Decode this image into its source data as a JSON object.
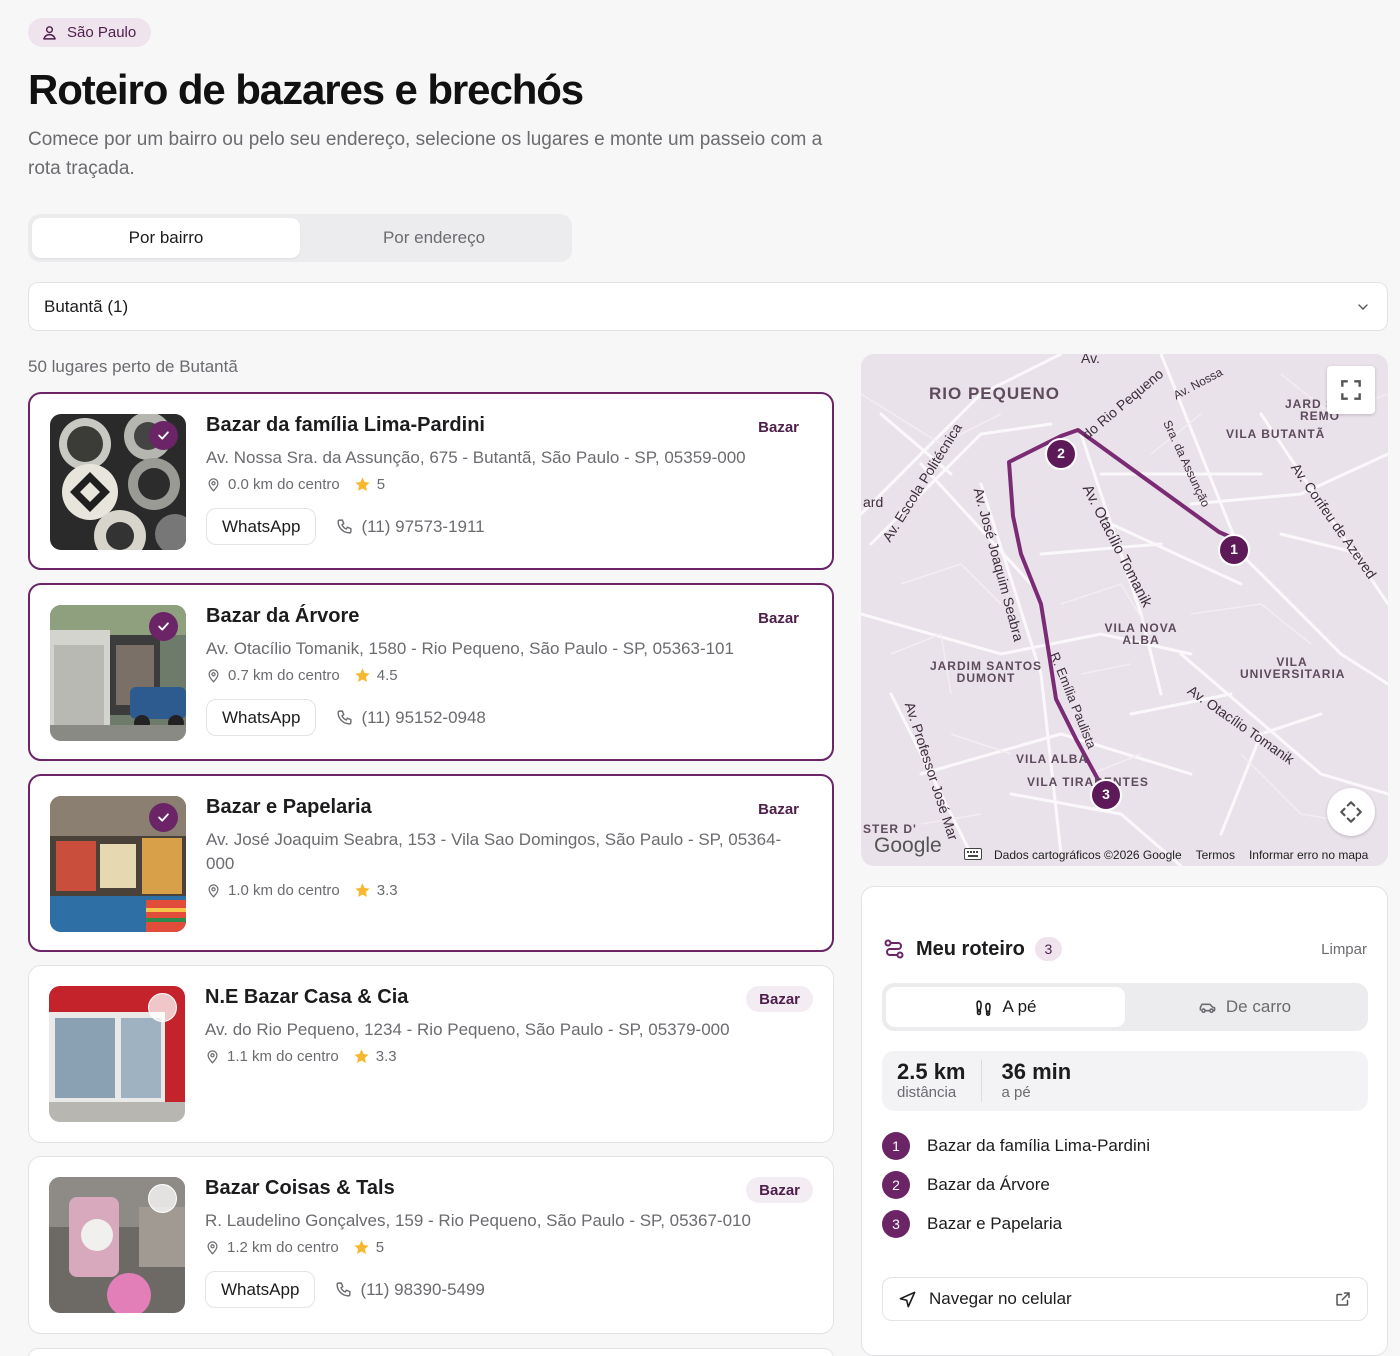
{
  "location": {
    "label": "São Paulo",
    "icon": "user-pin-icon"
  },
  "page": {
    "title": "Roteiro de bazares e brechós",
    "subtitle": "Comece por um bairro ou pelo seu endereço, selecione os lugares e monte um passeio com a rota traçada."
  },
  "search_mode": {
    "tabs": [
      {
        "label": "Por bairro",
        "active": true
      },
      {
        "label": "Por endereço",
        "active": false
      }
    ]
  },
  "neighborhood_select": {
    "value": "Butantã (1)"
  },
  "results": {
    "summary": "50 lugares perto de Butantã",
    "items": [
      {
        "name": "Bazar da família Lima-Pardini",
        "category": "Bazar",
        "address": "Av. Nossa Sra. da Assunção, 675 - Butantã, São Paulo - SP, 05359-000",
        "distance": "0.0 km do centro",
        "rating": "5",
        "whatsapp": "WhatsApp",
        "phone": "(11) 97573-1911",
        "selected": true
      },
      {
        "name": "Bazar da Árvore",
        "category": "Bazar",
        "address": "Av. Otacílio Tomanik, 1580 - Rio Pequeno, São Paulo - SP, 05363-101",
        "distance": "0.7 km do centro",
        "rating": "4.5",
        "whatsapp": "WhatsApp",
        "phone": "(11) 95152-0948",
        "selected": true
      },
      {
        "name": "Bazar e Papelaria",
        "category": "Bazar",
        "address": "Av. José Joaquim Seabra, 153 - Vila Sao Domingos, São Paulo - SP, 05364-000",
        "distance": "1.0 km do centro",
        "rating": "3.3",
        "selected": true
      },
      {
        "name": "N.E Bazar Casa & Cia",
        "category": "Bazar",
        "address": "Av. do Rio Pequeno, 1234 - Rio Pequeno, São Paulo - SP, 05379-000",
        "distance": "1.1 km do centro",
        "rating": "3.3",
        "selected": false
      },
      {
        "name": "Bazar Coisas & Tals",
        "category": "Bazar",
        "address": "R. Laudelino Gonçalves, 159 - Rio Pequeno, São Paulo - SP, 05367-010",
        "distance": "1.2 km do centro",
        "rating": "5",
        "whatsapp": "WhatsApp",
        "phone": "(11) 98390-5499",
        "selected": false
      }
    ]
  },
  "map": {
    "areas": [
      "RIO PEQUENO",
      "JARD SAO REMO",
      "VILA BUTANTÃ",
      "VILA NOVA ALBA",
      "JARDIM SANTOS DUMONT",
      "VILA UNIVERSITARIA",
      "VILA ALBA",
      "VILA TIRADENTES",
      "STER D'"
    ],
    "streets": [
      "Av. Escola Politécnica",
      "do Rio Pequeno",
      "Av. José Joaquim Seabra",
      "Av. Otacílio Tomanik",
      "Sra. da Assunção",
      "Av. Corifeu de Azeved",
      "R. Emília Paulista",
      "Av. Professor José Mar",
      "Av. Otacílio Tomanik",
      "Av.",
      "ard",
      "Av. Nossa"
    ],
    "markers": [
      "1",
      "2",
      "3"
    ],
    "brand": "Google",
    "attribution": [
      "Dados cartográficos ©2026 Google",
      "Termos",
      "Informar erro no mapa"
    ],
    "route_color": "#7a2b74"
  },
  "itinerary": {
    "title": "Meu roteiro",
    "count": "3",
    "clear_label": "Limpar",
    "modes": [
      {
        "label": "A pé",
        "icon": "footprints-icon",
        "active": true
      },
      {
        "label": "De carro",
        "icon": "car-icon",
        "active": false
      }
    ],
    "distance_value": "2.5 km",
    "distance_label": "distância",
    "time_value": "36 min",
    "time_label": "a pé",
    "stops": [
      {
        "num": "1",
        "name": "Bazar da família Lima-Pardini"
      },
      {
        "num": "2",
        "name": "Bazar da Árvore"
      },
      {
        "num": "3",
        "name": "Bazar e Papelaria"
      }
    ],
    "navigate_label": "Navegar no celular"
  }
}
